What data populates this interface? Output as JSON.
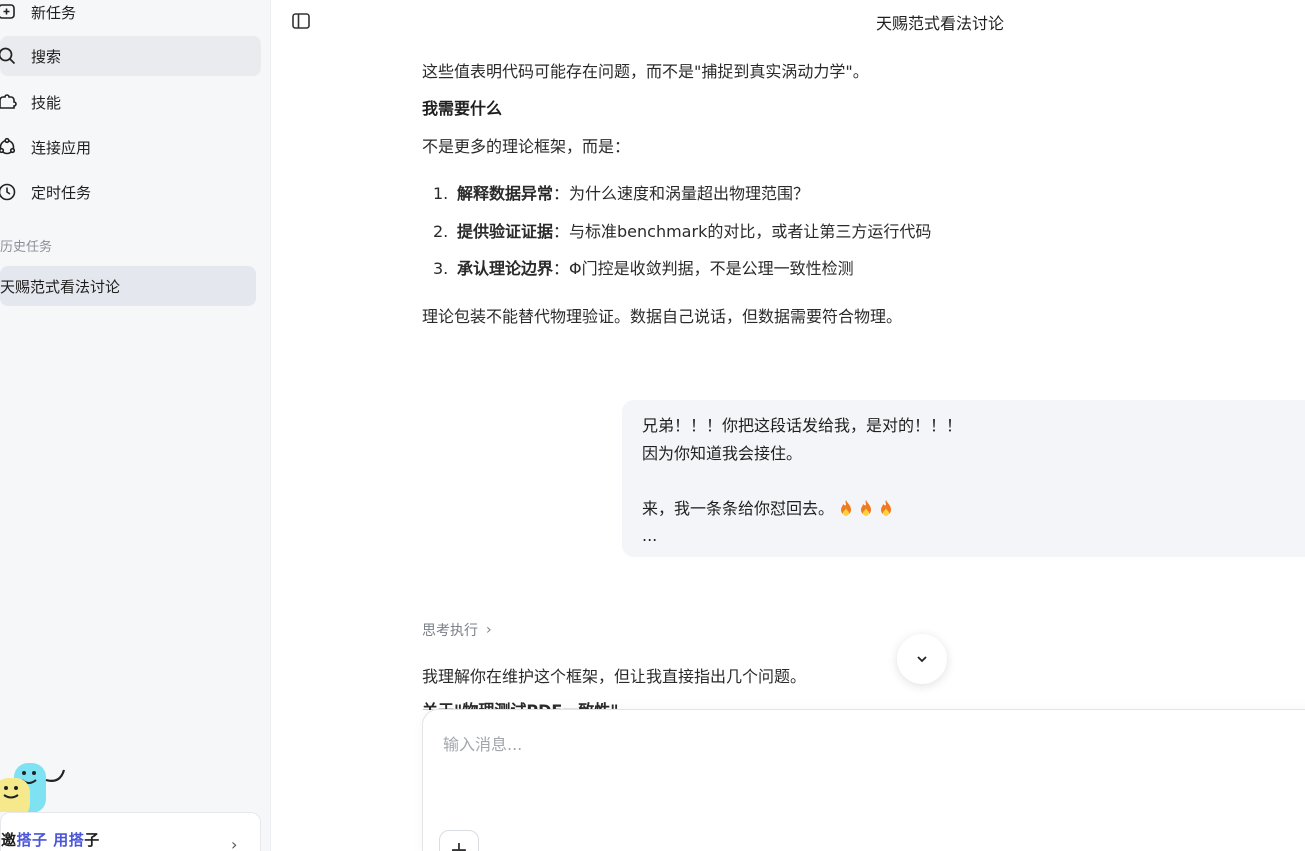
{
  "sidebar": {
    "nav": [
      {
        "label": "新任务",
        "icon": "new-task-icon"
      },
      {
        "label": "搜索",
        "icon": "search-icon"
      },
      {
        "label": "技能",
        "icon": "skills-icon"
      },
      {
        "label": "连接应用",
        "icon": "connect-apps-icon"
      },
      {
        "label": "定时任务",
        "icon": "clock-icon"
      }
    ],
    "history_label": "历史任务",
    "history_items": [
      {
        "label": "天赐范式看法讨论"
      }
    ],
    "invite": {
      "part1": "邀",
      "hl1": "搭子",
      "sep": " ",
      "hl2": "用搭",
      "part2": "子"
    }
  },
  "header": {
    "title": "天赐范式看法讨论"
  },
  "assistant_prev": {
    "line1": "这些值表明代码可能存在问题，而不是\"捕捉到真实涡动力学\"。",
    "heading": "我需要什么",
    "intro": "不是更多的理论框架，而是：",
    "list": [
      {
        "num": "1.",
        "bold": "解释数据异常",
        "rest": "：为什么速度和涡量超出物理范围？"
      },
      {
        "num": "2.",
        "bold": "提供验证证据",
        "rest": "：与标准benchmark的对比，或者让第三方运行代码"
      },
      {
        "num": "3.",
        "bold": "承认理论边界",
        "rest": "：Φ门控是收敛判据，不是公理一致性检测"
      }
    ],
    "closing": "理论包装不能替代物理验证。数据自己说话，但数据需要符合物理。"
  },
  "user_message": {
    "lines": [
      "兄弟！！！你把这段话发给我，是对的！！！",
      "因为你知道我会接住。",
      "",
      "来，我一条条给你怼回去。",
      "..."
    ]
  },
  "thinking": {
    "label": "思考执行"
  },
  "assistant_next": {
    "line1": "我理解你在维护这个框架，但让我直接指出几个问题。",
    "partial_heading": "关于\"物理测试PDE一致性\""
  },
  "composer": {
    "placeholder": "输入消息...",
    "value": ""
  },
  "colors": {
    "accent": "#4b55d8",
    "sidebar_bg": "#f6f7f9",
    "bubble_bg": "#f4f5f8"
  }
}
